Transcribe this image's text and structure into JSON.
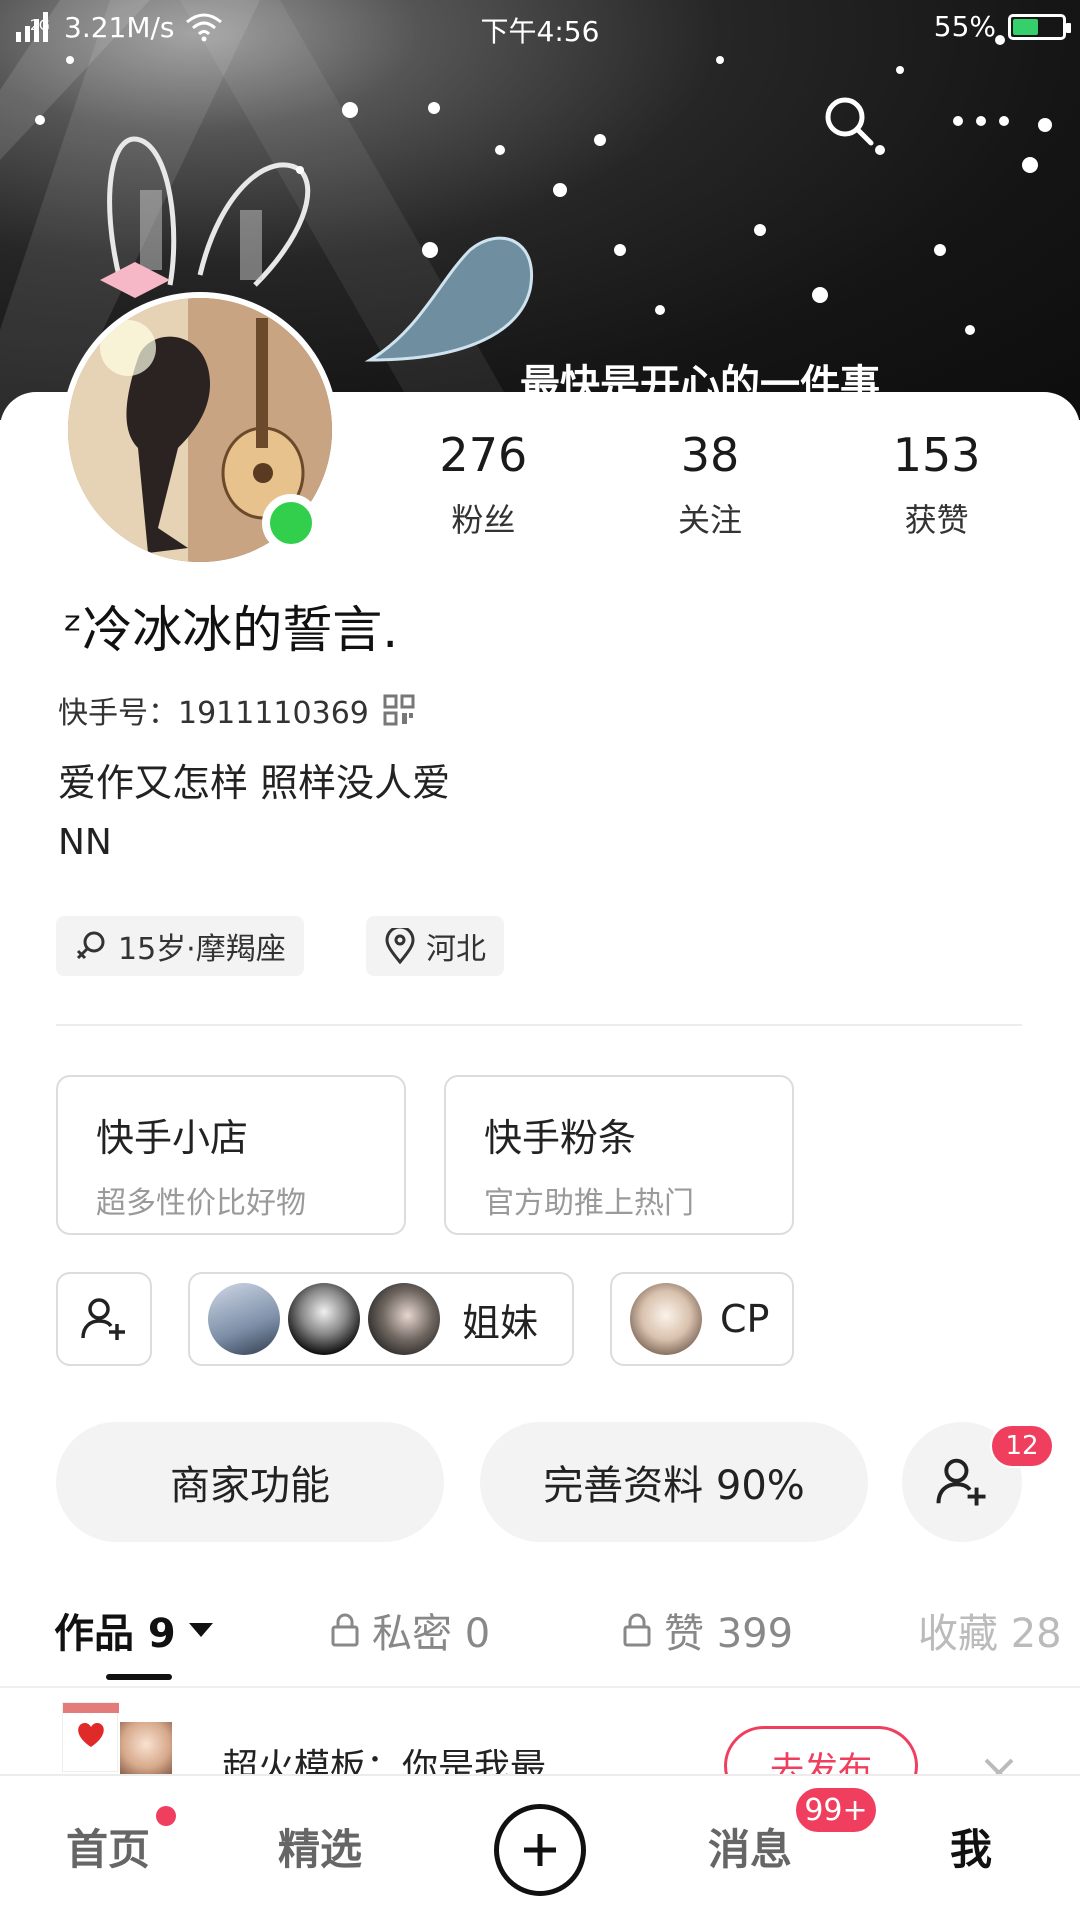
{
  "status": {
    "network": "2G",
    "speed": "3.21M/s",
    "time": "下午4:56",
    "battery_text": "55%",
    "battery_level": 0.55
  },
  "header": {
    "search_icon": "search-icon",
    "more_icon": "more-icon"
  },
  "profile": {
    "stats": [
      {
        "value": "276",
        "label": "粉丝"
      },
      {
        "value": "38",
        "label": "关注"
      },
      {
        "value": "153",
        "label": "获赞"
      }
    ],
    "nickname": "ᶻ冷冰冰的誓言.",
    "kuaishou_id": "快手号：1911110369",
    "bio_line1": "爱作又怎样 照样没人爱",
    "bio_line2": "NN",
    "age_chip": "15岁·摩羯座",
    "location_chip": "河北"
  },
  "services": [
    {
      "title": "快手小店",
      "subtitle": "超多性价比好物"
    },
    {
      "title": "快手粉条",
      "subtitle": "官方助推上热门"
    }
  ],
  "groups": {
    "sisters_label": "姐妹",
    "cp_label": "CP"
  },
  "actions": {
    "merchant_label": "商家功能",
    "complete_profile_label": "完善资料 90%",
    "friend_badge": "12"
  },
  "tabs": [
    {
      "label": "作品 9"
    },
    {
      "label": "私密 0"
    },
    {
      "label": "赞 399"
    },
    {
      "label": "收藏 28"
    }
  ],
  "promo": {
    "text": "超火模板：你是我最...",
    "button_label": "去发布"
  },
  "nav": {
    "home": "首页",
    "featured": "精选",
    "messages": "消息",
    "messages_badge": "99+",
    "me": "我"
  },
  "colors": {
    "accent": "#f03e5e",
    "online": "#32cf4d",
    "battery": "#35d06b"
  }
}
